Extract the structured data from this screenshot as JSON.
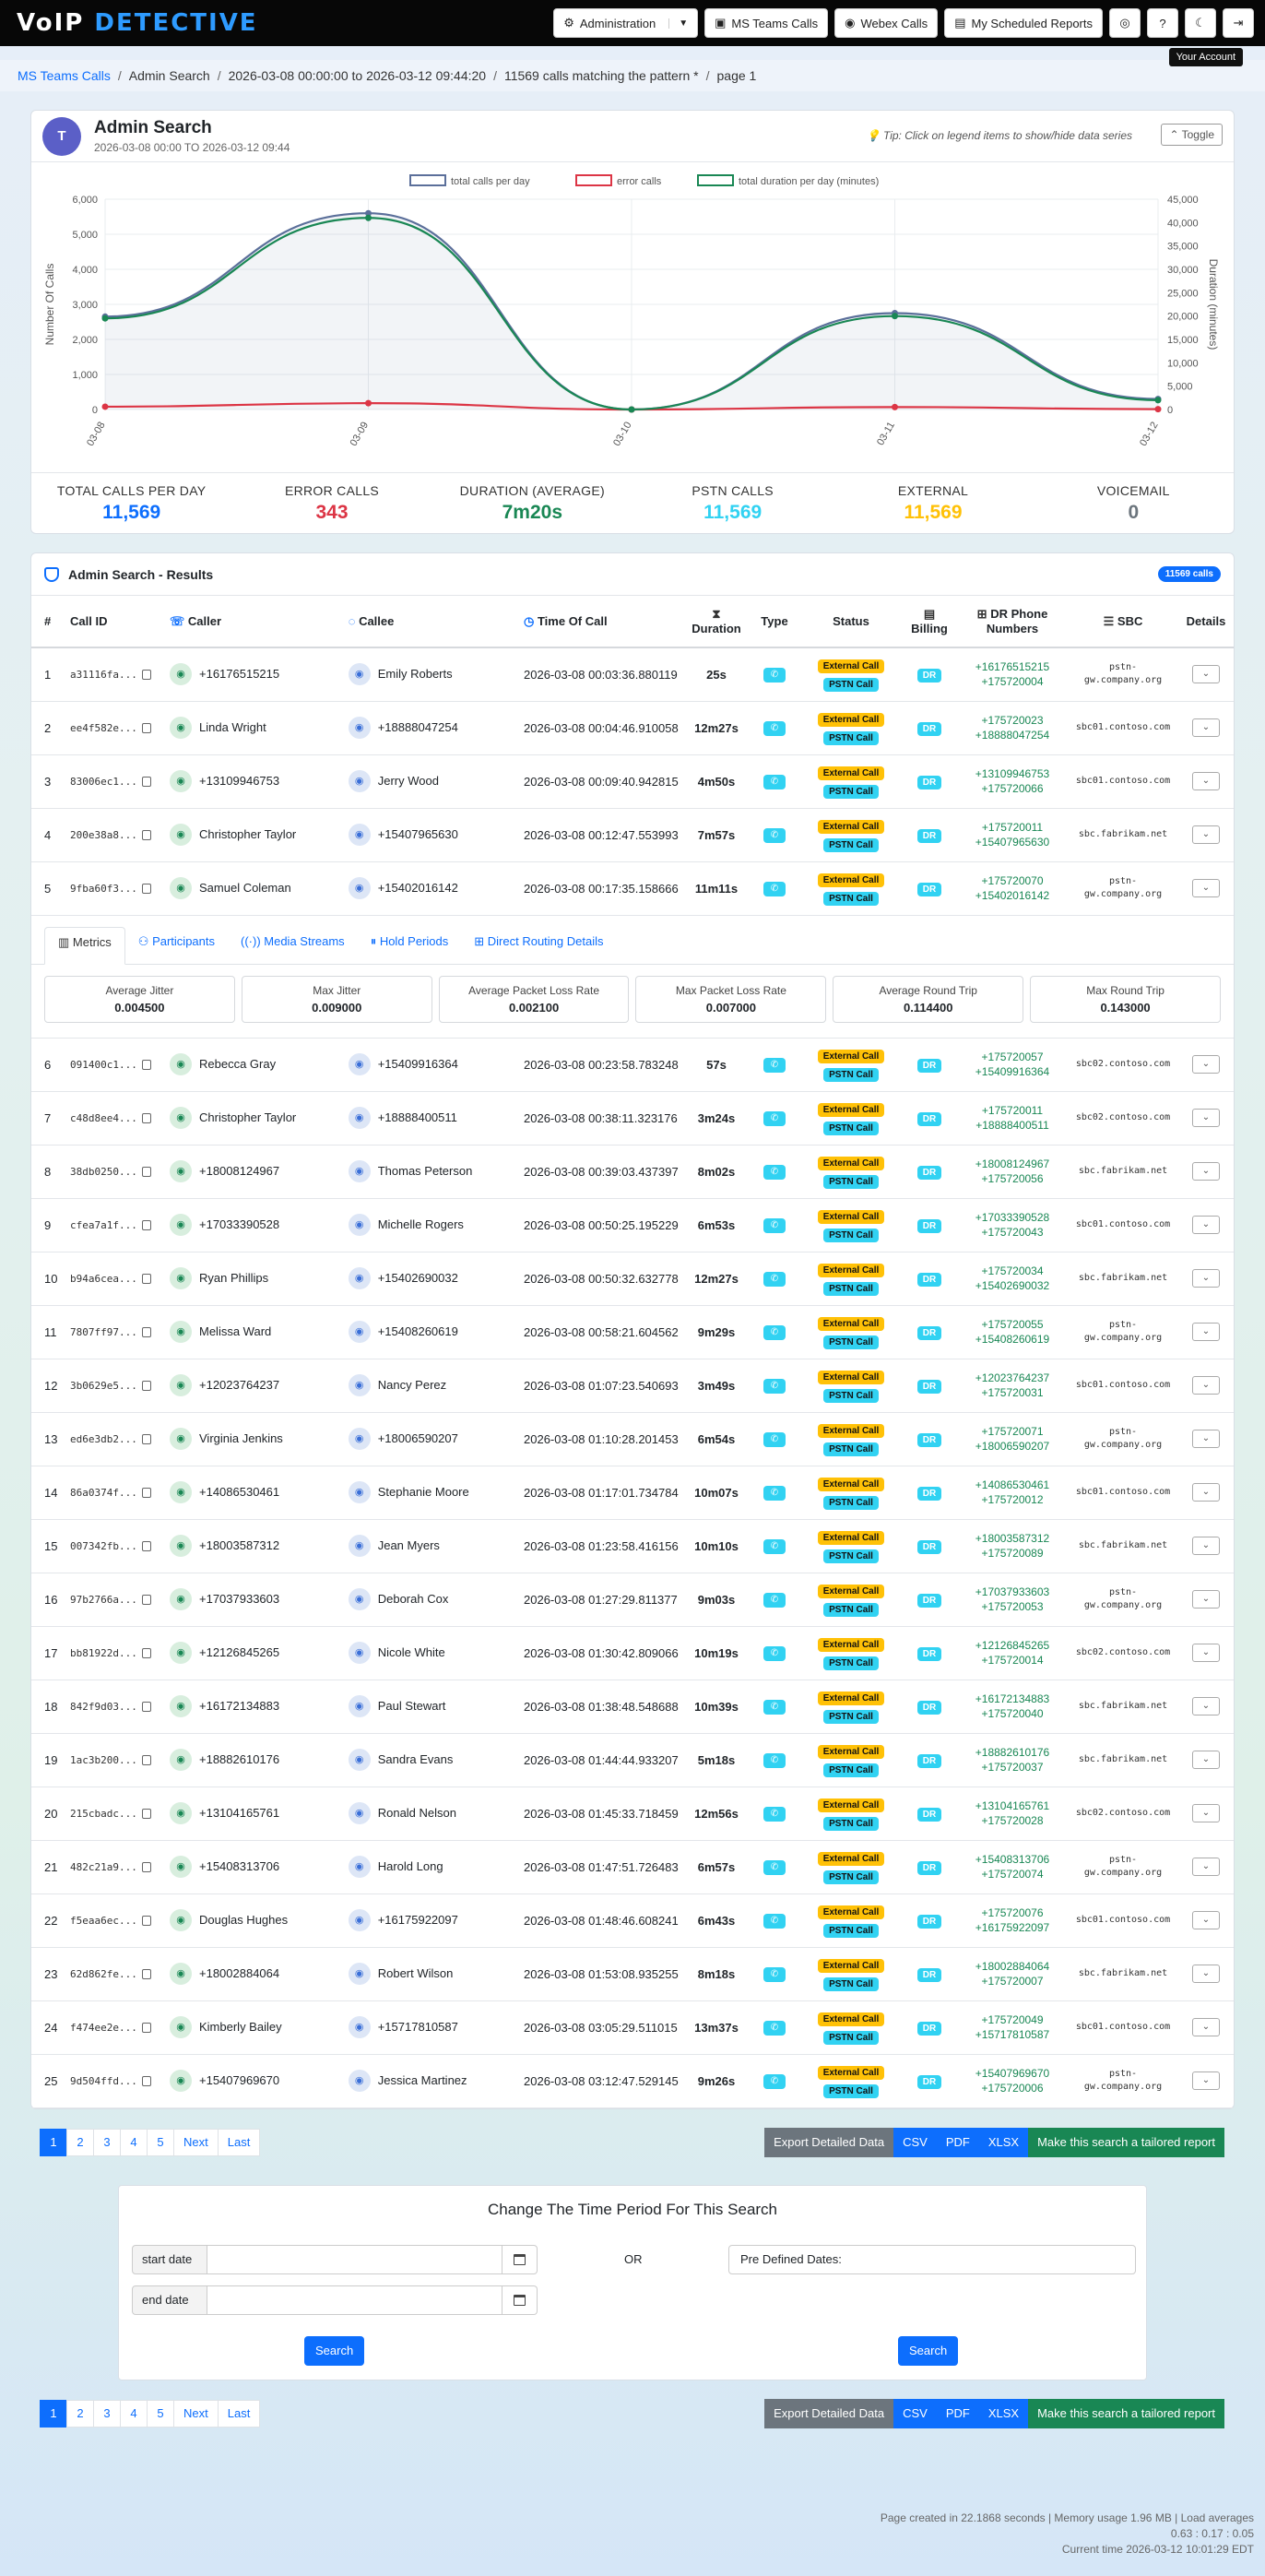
{
  "nav": {
    "logo_a": "VoIP",
    "logo_b": "DETECTIVE",
    "admin": "Administration",
    "teams": "MS Teams Calls",
    "webex": "Webex Calls",
    "reports": "My Scheduled Reports",
    "tooltip": "Your Account"
  },
  "crumbs": [
    "MS Teams Calls",
    "Admin Search",
    "2026-03-08 00:00:00 to 2026-03-12 09:44:20",
    "11569 calls matching the pattern *",
    "page 1"
  ],
  "summary": {
    "title": "Admin Search",
    "subtitle": "2026-03-08 00:00 TO 2026-03-12 09:44",
    "tip": "Tip: Click on legend items to show/hide data series",
    "toggle": "Toggle"
  },
  "chart_data": {
    "type": "line",
    "x": [
      "03-08",
      "03-09",
      "03-10",
      "03-11",
      "03-12"
    ],
    "series": [
      {
        "name": "total calls per day",
        "values": [
          2650,
          5600,
          0,
          2750,
          300
        ],
        "axis": "left",
        "color": "#5b6f9a"
      },
      {
        "name": "error calls",
        "values": [
          80,
          180,
          0,
          70,
          10
        ],
        "axis": "left",
        "color": "#dc3545"
      },
      {
        "name": "total duration per day (minutes)",
        "values": [
          19500,
          41000,
          0,
          20000,
          2000
        ],
        "axis": "right",
        "color": "#198754"
      }
    ],
    "ylabel": "Number Of Calls",
    "y2label": "Duration (minutes)",
    "ylim": [
      0,
      6000
    ],
    "y2lim": [
      0,
      45000
    ],
    "yticks": [
      "0",
      "1,000",
      "2,000",
      "3,000",
      "4,000",
      "5,000",
      "6,000"
    ],
    "y2ticks": [
      "0",
      "5,000",
      "10,000",
      "15,000",
      "20,000",
      "25,000",
      "30,000",
      "35,000",
      "40,000",
      "45,000"
    ],
    "legend": "top"
  },
  "stats": [
    {
      "label": "Total Calls Per Day",
      "value": "11,569",
      "color": "#0d6efd"
    },
    {
      "label": "Error Calls",
      "value": "343",
      "color": "#dc3545"
    },
    {
      "label": "Duration (Average)",
      "value": "7m20s",
      "color": "#198754"
    },
    {
      "label": "PSTN Calls",
      "value": "11,569",
      "color": "#31d2f2"
    },
    {
      "label": "External",
      "value": "11,569",
      "color": "#ffc107"
    },
    {
      "label": "Voicemail",
      "value": "0",
      "color": "#6c757d"
    }
  ],
  "results": {
    "title": "Admin Search - Results",
    "badge": "11569 calls",
    "headers": [
      "#",
      "Call ID",
      "Caller",
      "Callee",
      "Time Of Call",
      "Duration",
      "Type",
      "Status",
      "Billing",
      "DR Phone Numbers",
      "SBC",
      "Details"
    ],
    "ext": "External Call",
    "pstn": "PSTN Call",
    "dr": "DR"
  },
  "rows": [
    [
      "1",
      "a31116fa...",
      "+16176515215",
      "Emily Roberts",
      "2026-03-08 00:03:36.880119",
      "25s",
      "+16176515215",
      "+175720004",
      "pstn-gw.company.org"
    ],
    [
      "2",
      "ee4f582e...",
      "Linda Wright",
      "+18888047254",
      "2026-03-08 00:04:46.910058",
      "12m27s",
      "+175720023",
      "+18888047254",
      "sbc01.contoso.com"
    ],
    [
      "3",
      "83006ec1...",
      "+13109946753",
      "Jerry Wood",
      "2026-03-08 00:09:40.942815",
      "4m50s",
      "+13109946753",
      "+175720066",
      "sbc01.contoso.com"
    ],
    [
      "4",
      "200e38a8...",
      "Christopher Taylor",
      "+15407965630",
      "2026-03-08 00:12:47.553993",
      "7m57s",
      "+175720011",
      "+15407965630",
      "sbc.fabrikam.net"
    ],
    [
      "5",
      "9fba60f3...",
      "Samuel Coleman",
      "+15402016142",
      "2026-03-08 00:17:35.158666",
      "11m11s",
      "+175720070",
      "+15402016142",
      "pstn-gw.company.org"
    ],
    [
      "6",
      "091400c1...",
      "Rebecca Gray",
      "+15409916364",
      "2026-03-08 00:23:58.783248",
      "57s",
      "+175720057",
      "+15409916364",
      "sbc02.contoso.com"
    ],
    [
      "7",
      "c48d8ee4...",
      "Christopher Taylor",
      "+18888400511",
      "2026-03-08 00:38:11.323176",
      "3m24s",
      "+175720011",
      "+18888400511",
      "sbc02.contoso.com"
    ],
    [
      "8",
      "38db0250...",
      "+18008124967",
      "Thomas Peterson",
      "2026-03-08 00:39:03.437397",
      "8m02s",
      "+18008124967",
      "+175720056",
      "sbc.fabrikam.net"
    ],
    [
      "9",
      "cfea7a1f...",
      "+17033390528",
      "Michelle Rogers",
      "2026-03-08 00:50:25.195229",
      "6m53s",
      "+17033390528",
      "+175720043",
      "sbc01.contoso.com"
    ],
    [
      "10",
      "b94a6cea...",
      "Ryan Phillips",
      "+15402690032",
      "2026-03-08 00:50:32.632778",
      "12m27s",
      "+175720034",
      "+15402690032",
      "sbc.fabrikam.net"
    ],
    [
      "11",
      "7807ff97...",
      "Melissa Ward",
      "+15408260619",
      "2026-03-08 00:58:21.604562",
      "9m29s",
      "+175720055",
      "+15408260619",
      "pstn-gw.company.org"
    ],
    [
      "12",
      "3b0629e5...",
      "+12023764237",
      "Nancy Perez",
      "2026-03-08 01:07:23.540693",
      "3m49s",
      "+12023764237",
      "+175720031",
      "sbc01.contoso.com"
    ],
    [
      "13",
      "ed6e3db2...",
      "Virginia Jenkins",
      "+18006590207",
      "2026-03-08 01:10:28.201453",
      "6m54s",
      "+175720071",
      "+18006590207",
      "pstn-gw.company.org"
    ],
    [
      "14",
      "86a0374f...",
      "+14086530461",
      "Stephanie Moore",
      "2026-03-08 01:17:01.734784",
      "10m07s",
      "+14086530461",
      "+175720012",
      "sbc01.contoso.com"
    ],
    [
      "15",
      "007342fb...",
      "+18003587312",
      "Jean Myers",
      "2026-03-08 01:23:58.416156",
      "10m10s",
      "+18003587312",
      "+175720089",
      "sbc.fabrikam.net"
    ],
    [
      "16",
      "97b2766a...",
      "+17037933603",
      "Deborah Cox",
      "2026-03-08 01:27:29.811377",
      "9m03s",
      "+17037933603",
      "+175720053",
      "pstn-gw.company.org"
    ],
    [
      "17",
      "bb81922d...",
      "+12126845265",
      "Nicole White",
      "2026-03-08 01:30:42.809066",
      "10m19s",
      "+12126845265",
      "+175720014",
      "sbc02.contoso.com"
    ],
    [
      "18",
      "842f9d03...",
      "+16172134883",
      "Paul Stewart",
      "2026-03-08 01:38:48.548688",
      "10m39s",
      "+16172134883",
      "+175720040",
      "sbc.fabrikam.net"
    ],
    [
      "19",
      "1ac3b200...",
      "+18882610176",
      "Sandra Evans",
      "2026-03-08 01:44:44.933207",
      "5m18s",
      "+18882610176",
      "+175720037",
      "sbc.fabrikam.net"
    ],
    [
      "20",
      "215cbadc...",
      "+13104165761",
      "Ronald Nelson",
      "2026-03-08 01:45:33.718459",
      "12m56s",
      "+13104165761",
      "+175720028",
      "sbc02.contoso.com"
    ],
    [
      "21",
      "482c21a9...",
      "+15408313706",
      "Harold Long",
      "2026-03-08 01:47:51.726483",
      "6m57s",
      "+15408313706",
      "+175720074",
      "pstn-gw.company.org"
    ],
    [
      "22",
      "f5eaa6ec...",
      "Douglas Hughes",
      "+16175922097",
      "2026-03-08 01:48:46.608241",
      "6m43s",
      "+175720076",
      "+16175922097",
      "sbc01.contoso.com"
    ],
    [
      "23",
      "62d862fe...",
      "+18002884064",
      "Robert Wilson",
      "2026-03-08 01:53:08.935255",
      "8m18s",
      "+18002884064",
      "+175720007",
      "sbc.fabrikam.net"
    ],
    [
      "24",
      "f474ee2e...",
      "Kimberly Bailey",
      "+15717810587",
      "2026-03-08 03:05:29.511015",
      "13m37s",
      "+175720049",
      "+15717810587",
      "sbc01.contoso.com"
    ],
    [
      "25",
      "9d504ffd...",
      "+15407969670",
      "Jessica Martinez",
      "2026-03-08 03:12:47.529145",
      "9m26s",
      "+15407969670",
      "+175720006",
      "pstn-gw.company.org"
    ]
  ],
  "details": {
    "tabs": [
      "Metrics",
      "Participants",
      "Media Streams",
      "Hold Periods",
      "Direct Routing Details"
    ],
    "metrics": [
      {
        "label": "Average Jitter",
        "value": "0.004500"
      },
      {
        "label": "Max Jitter",
        "value": "0.009000"
      },
      {
        "label": "Average Packet Loss Rate",
        "value": "0.002100"
      },
      {
        "label": "Max Packet Loss Rate",
        "value": "0.007000"
      },
      {
        "label": "Average Round Trip",
        "value": "0.114400"
      },
      {
        "label": "Max Round Trip",
        "value": "0.143000"
      }
    ]
  },
  "pager": [
    "1",
    "2",
    "3",
    "4",
    "5",
    "Next",
    "Last"
  ],
  "export": {
    "detailed": "Export Detailed Data",
    "csv": "CSV",
    "pdf": "PDF",
    "xlsx": "XLSX",
    "report": "Make this search a tailored report"
  },
  "period": {
    "title": "Change The Time Period For This Search",
    "start": "start date",
    "end": "end date",
    "or": "OR",
    "predef": "Pre Defined Dates:",
    "search": "Search"
  },
  "footer": [
    "Page created in 22.1868 seconds | Memory usage 1.96 MB | Load averages",
    "0.63 : 0.17 : 0.05",
    "Current time 2026-03-12 10:01:29 EDT"
  ]
}
